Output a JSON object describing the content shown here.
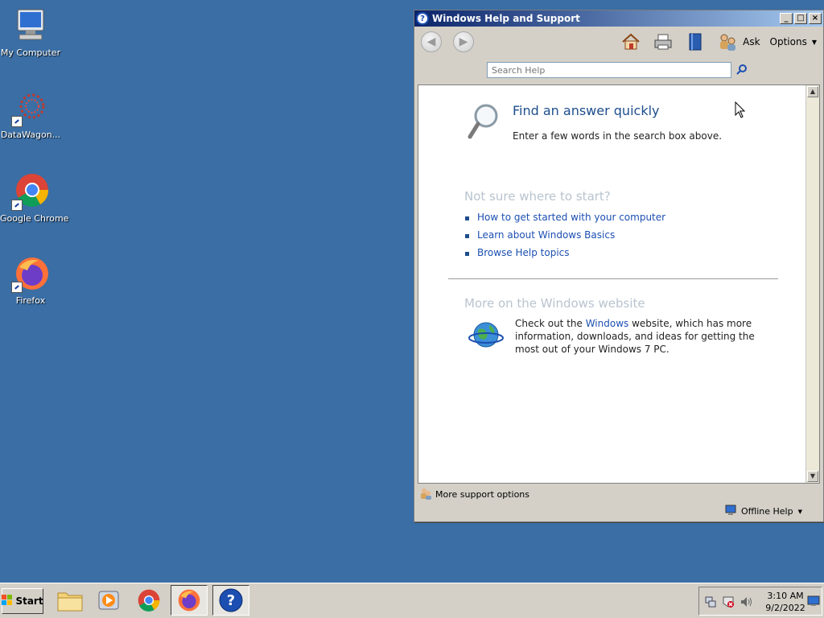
{
  "desktop": {
    "icons": [
      {
        "label": "My Computer"
      },
      {
        "label": "DataWagon..."
      },
      {
        "label": "Google Chrome"
      },
      {
        "label": "Firefox"
      }
    ]
  },
  "window": {
    "title": "Windows Help and Support",
    "toolbar": {
      "ask_label": "Ask",
      "options_label": "Options"
    },
    "search": {
      "placeholder": "Search Help"
    },
    "find": {
      "title": "Find an answer quickly",
      "subtitle": "Enter a few words in the search box above."
    },
    "start_section": {
      "title": "Not sure where to start?",
      "links": [
        "How to get started with your computer",
        "Learn about Windows Basics",
        "Browse Help topics"
      ]
    },
    "website_section": {
      "title": "More on the Windows website",
      "text_before": "Check out the ",
      "link": "Windows",
      "text_after": " website, which has more information, downloads, and ideas for getting the most out of your Windows 7 PC."
    },
    "status": {
      "support": "More support options",
      "offline": "Offline Help"
    }
  },
  "taskbar": {
    "start_label": "Start",
    "clock": {
      "time": "3:10 AM",
      "date": "9/2/2022"
    }
  },
  "colors": {
    "desktop": "#3a6ea5",
    "link": "#1c4fb1",
    "heading": "#1e4e8c"
  }
}
